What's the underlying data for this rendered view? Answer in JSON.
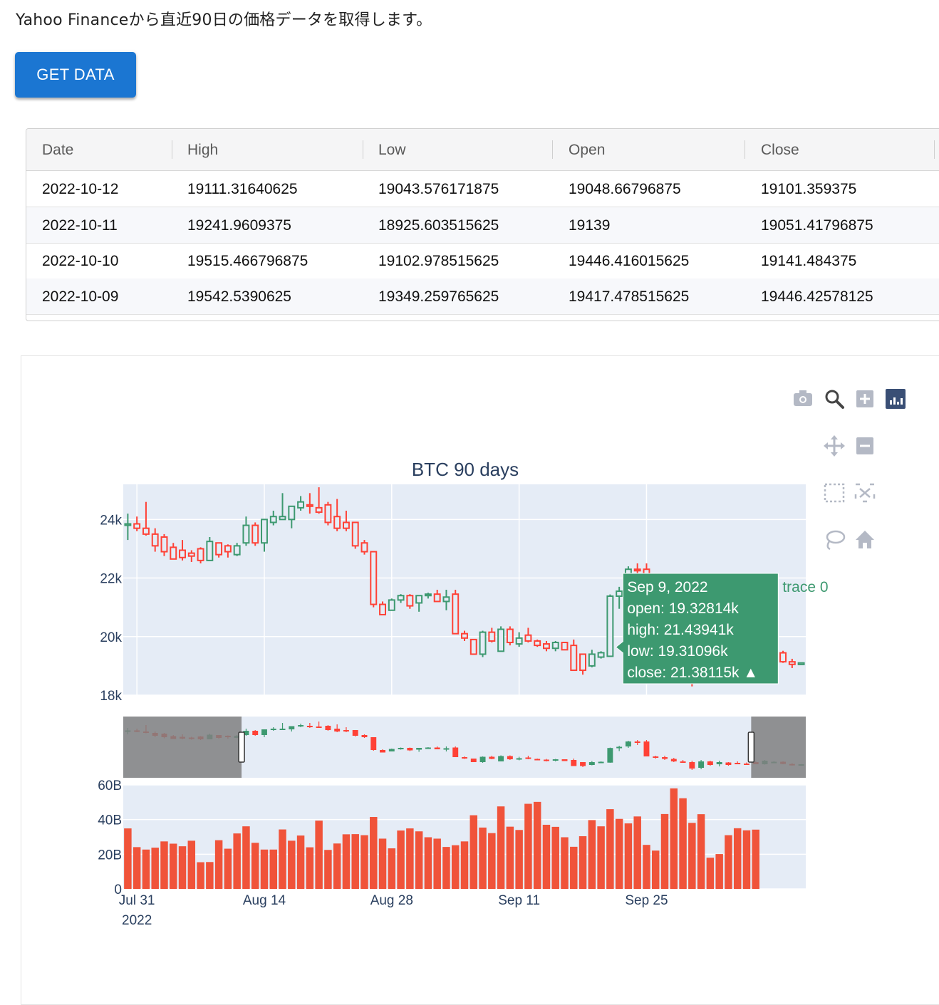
{
  "intro": {
    "text": "Yahoo Financeから直近90日の価格データを取得します。"
  },
  "button": {
    "label": "GET DATA"
  },
  "table": {
    "columns": [
      "Date",
      "High",
      "Low",
      "Open",
      "Close"
    ],
    "rows": [
      [
        "2022-10-12",
        "19111.31640625",
        "19043.576171875",
        "19048.66796875",
        "19101.359375"
      ],
      [
        "2022-10-11",
        "19241.9609375",
        "18925.603515625",
        "19139",
        "19051.41796875"
      ],
      [
        "2022-10-10",
        "19515.466796875",
        "19102.978515625",
        "19446.416015625",
        "19141.484375"
      ],
      [
        "2022-10-09",
        "19542.5390625",
        "19349.259765625",
        "19417.478515625",
        "19446.42578125"
      ]
    ]
  },
  "chart": {
    "title": "BTC 90 days",
    "colors": {
      "up": "#3d9970",
      "down": "#ff4136",
      "volume": "#f0533a",
      "plot_bg": "#e5ecf6",
      "title": "#2a3f5f",
      "tooltip_bg": "#3d9970",
      "range_mask": "#808080",
      "modebar_icon": "#b4b9c5",
      "modebar_active": "#3a4f75"
    },
    "hover": {
      "date": "Sep 9, 2022",
      "lines": [
        "open: 19.32814k",
        "high: 21.43941k",
        "low: 19.31096k",
        "close: 21.38115k  ▲"
      ],
      "trace": "trace 0"
    },
    "modebar": [
      "camera-icon",
      "zoom-icon",
      "zoom-in-icon",
      "bar-chart-icon",
      "pan-icon",
      "zoom-out-icon",
      "box-select-icon",
      "autoscale-icon",
      "lasso-icon",
      "home-icon"
    ]
  },
  "chart_data": [
    {
      "type": "candlestick",
      "title": "BTC 90 days",
      "xlabel": "",
      "ylabel": "",
      "x_start": "2022-07-30",
      "x_end": "2022-10-12",
      "visible_range": [
        "2022-07-30",
        "2022-10-12"
      ],
      "y_ticks": [
        "18k",
        "20k",
        "22k",
        "24k"
      ],
      "ylim": [
        18000,
        25200
      ],
      "x_ticks": [
        "Jul 31\n2022",
        "Aug 14",
        "Aug 28",
        "Sep 11",
        "Sep 25"
      ],
      "ohlc": [
        {
          "date": "2022-07-30",
          "o": 23800,
          "h": 24200,
          "l": 23300,
          "c": 23850
        },
        {
          "date": "2022-07-31",
          "o": 23850,
          "h": 24100,
          "l": 23600,
          "c": 23700
        },
        {
          "date": "2022-08-01",
          "o": 23700,
          "h": 24600,
          "l": 23450,
          "c": 23500
        },
        {
          "date": "2022-08-02",
          "o": 23500,
          "h": 23700,
          "l": 22900,
          "c": 23100
        },
        {
          "date": "2022-08-03",
          "o": 23400,
          "h": 23500,
          "l": 22750,
          "c": 22900
        },
        {
          "date": "2022-08-04",
          "o": 23050,
          "h": 23200,
          "l": 22650,
          "c": 22650
        },
        {
          "date": "2022-08-05",
          "o": 22950,
          "h": 23300,
          "l": 22600,
          "c": 22700
        },
        {
          "date": "2022-08-06",
          "o": 22850,
          "h": 22950,
          "l": 22550,
          "c": 22750
        },
        {
          "date": "2022-08-07",
          "o": 23000,
          "h": 23050,
          "l": 22500,
          "c": 22600
        },
        {
          "date": "2022-08-08",
          "o": 22600,
          "h": 23400,
          "l": 22600,
          "c": 23250
        },
        {
          "date": "2022-08-09",
          "o": 23200,
          "h": 23200,
          "l": 22700,
          "c": 22800
        },
        {
          "date": "2022-08-10",
          "o": 23100,
          "h": 23150,
          "l": 22700,
          "c": 22900
        },
        {
          "date": "2022-08-11",
          "o": 22800,
          "h": 23200,
          "l": 22750,
          "c": 23100
        },
        {
          "date": "2022-08-12",
          "o": 23200,
          "h": 24100,
          "l": 23100,
          "c": 23800
        },
        {
          "date": "2022-08-13",
          "o": 23800,
          "h": 23900,
          "l": 23100,
          "c": 23200
        },
        {
          "date": "2022-08-14",
          "o": 23200,
          "h": 24000,
          "l": 22900,
          "c": 24000
        },
        {
          "date": "2022-08-15",
          "o": 23900,
          "h": 24300,
          "l": 23800,
          "c": 24100
        },
        {
          "date": "2022-08-16",
          "o": 24000,
          "h": 24900,
          "l": 24000,
          "c": 24100
        },
        {
          "date": "2022-08-17",
          "o": 24000,
          "h": 24400,
          "l": 23700,
          "c": 24450
        },
        {
          "date": "2022-08-18",
          "o": 24400,
          "h": 24800,
          "l": 24300,
          "c": 24600
        },
        {
          "date": "2022-08-19",
          "o": 24500,
          "h": 24900,
          "l": 24200,
          "c": 24450
        },
        {
          "date": "2022-08-20",
          "o": 24400,
          "h": 25100,
          "l": 24200,
          "c": 24250
        },
        {
          "date": "2022-08-21",
          "o": 24500,
          "h": 24600,
          "l": 23800,
          "c": 23900
        },
        {
          "date": "2022-08-22",
          "o": 24100,
          "h": 24700,
          "l": 23600,
          "c": 23700
        },
        {
          "date": "2022-08-23",
          "o": 23900,
          "h": 24300,
          "l": 23600,
          "c": 23700
        },
        {
          "date": "2022-08-24",
          "o": 23900,
          "h": 23900,
          "l": 23000,
          "c": 23100
        },
        {
          "date": "2022-08-25",
          "o": 23200,
          "h": 23300,
          "l": 22800,
          "c": 22900
        },
        {
          "date": "2022-08-26",
          "o": 22900,
          "h": 22900,
          "l": 21000,
          "c": 21100
        },
        {
          "date": "2022-08-27",
          "o": 21100,
          "h": 21200,
          "l": 20750,
          "c": 20750
        },
        {
          "date": "2022-08-28",
          "o": 20900,
          "h": 21300,
          "l": 20900,
          "c": 21250
        },
        {
          "date": "2022-08-29",
          "o": 21250,
          "h": 21450,
          "l": 21150,
          "c": 21400
        },
        {
          "date": "2022-08-30",
          "o": 21400,
          "h": 21450,
          "l": 20950,
          "c": 21050
        },
        {
          "date": "2022-08-31",
          "o": 21150,
          "h": 21400,
          "l": 20850,
          "c": 21400
        },
        {
          "date": "2022-09-01",
          "o": 21400,
          "h": 21500,
          "l": 21300,
          "c": 21450
        },
        {
          "date": "2022-09-02",
          "o": 21450,
          "h": 21600,
          "l": 21200,
          "c": 21200
        },
        {
          "date": "2022-09-03",
          "o": 21200,
          "h": 21600,
          "l": 20900,
          "c": 21350
        },
        {
          "date": "2022-09-04",
          "o": 21450,
          "h": 21600,
          "l": 21000,
          "c": 20100
        },
        {
          "date": "2022-09-05",
          "o": 20100,
          "h": 20200,
          "l": 19850,
          "c": 19950
        },
        {
          "date": "2022-09-06",
          "o": 19900,
          "h": 19900,
          "l": 19400,
          "c": 19400
        },
        {
          "date": "2022-09-07",
          "o": 19400,
          "h": 20200,
          "l": 19300,
          "c": 20150
        },
        {
          "date": "2022-09-08",
          "o": 20150,
          "h": 20300,
          "l": 19800,
          "c": 19850
        },
        {
          "date": "2022-09-09",
          "o": 19500,
          "h": 20350,
          "l": 19500,
          "c": 20250
        },
        {
          "date": "2022-09-10",
          "o": 20250,
          "h": 20350,
          "l": 19700,
          "c": 19800
        },
        {
          "date": "2022-09-11",
          "o": 19750,
          "h": 20150,
          "l": 19650,
          "c": 19950
        },
        {
          "date": "2022-09-12",
          "o": 20050,
          "h": 20300,
          "l": 19800,
          "c": 19850
        },
        {
          "date": "2022-09-13",
          "o": 19850,
          "h": 19900,
          "l": 19650,
          "c": 19700
        },
        {
          "date": "2022-09-14",
          "o": 19750,
          "h": 19850,
          "l": 19500,
          "c": 19600
        },
        {
          "date": "2022-09-15",
          "o": 19600,
          "h": 19850,
          "l": 19500,
          "c": 19800
        },
        {
          "date": "2022-09-16",
          "o": 19800,
          "h": 19800,
          "l": 19550,
          "c": 19550
        },
        {
          "date": "2022-09-17",
          "o": 19700,
          "h": 19900,
          "l": 18900,
          "c": 18850
        },
        {
          "date": "2022-09-18",
          "o": 19400,
          "h": 19400,
          "l": 18700,
          "c": 18850
        },
        {
          "date": "2022-09-19",
          "o": 19000,
          "h": 19550,
          "l": 18950,
          "c": 19400
        },
        {
          "date": "2022-09-20",
          "o": 19300,
          "h": 19500,
          "l": 19250,
          "c": 19450
        },
        {
          "date": "2022-09-21",
          "o": 19328,
          "h": 21439,
          "l": 19311,
          "c": 21381
        },
        {
          "date": "2022-09-22",
          "o": 21381,
          "h": 21700,
          "l": 20950,
          "c": 21550
        },
        {
          "date": "2022-09-23",
          "o": 21600,
          "h": 22400,
          "l": 21400,
          "c": 22300
        },
        {
          "date": "2022-09-24",
          "o": 22300,
          "h": 22500,
          "l": 21800,
          "c": 22250
        },
        {
          "date": "2022-09-25",
          "o": 22300,
          "h": 22500,
          "l": 21600,
          "c": 20200
        },
        {
          "date": "2022-09-26",
          "o": 20200,
          "h": 20300,
          "l": 19900,
          "c": 20000
        },
        {
          "date": "2022-09-27",
          "o": 20100,
          "h": 20300,
          "l": 19700,
          "c": 19850
        },
        {
          "date": "2022-09-28",
          "o": 19850,
          "h": 20000,
          "l": 19400,
          "c": 19500
        },
        {
          "date": "2022-09-29",
          "o": 19500,
          "h": 19700,
          "l": 19300,
          "c": 19400
        },
        {
          "date": "2022-09-30",
          "o": 19400,
          "h": 19600,
          "l": 18300,
          "c": 18500
        },
        {
          "date": "2022-10-01",
          "o": 18600,
          "h": 19700,
          "l": 18400,
          "c": 19500
        },
        {
          "date": "2022-10-02",
          "o": 19500,
          "h": 19600,
          "l": 18900,
          "c": 19000
        },
        {
          "date": "2022-10-03",
          "o": 19100,
          "h": 19600,
          "l": 18800,
          "c": 19400
        },
        {
          "date": "2022-10-04",
          "o": 19350,
          "h": 19400,
          "l": 18900,
          "c": 19000
        },
        {
          "date": "2022-10-05",
          "o": 19300,
          "h": 19500,
          "l": 19100,
          "c": 19200
        },
        {
          "date": "2022-10-06",
          "o": 19200,
          "h": 19350,
          "l": 19000,
          "c": 19100
        },
        {
          "date": "2022-10-07",
          "o": 19400,
          "h": 19500,
          "l": 19100,
          "c": 19100
        },
        {
          "date": "2022-10-08",
          "o": 19100,
          "h": 19700,
          "l": 19050,
          "c": 19600
        },
        {
          "date": "2022-10-09",
          "o": 19417,
          "h": 19543,
          "l": 19349,
          "c": 19446
        },
        {
          "date": "2022-10-10",
          "o": 19446,
          "h": 19515,
          "l": 19103,
          "c": 19141
        },
        {
          "date": "2022-10-11",
          "o": 19139,
          "h": 19242,
          "l": 18926,
          "c": 19051
        },
        {
          "date": "2022-10-12",
          "o": 19049,
          "h": 19111,
          "l": 19044,
          "c": 19101
        }
      ]
    },
    {
      "type": "bar",
      "title": "",
      "y_ticks": [
        "0",
        "20B",
        "40B",
        "60B"
      ],
      "ylim": [
        0,
        60
      ],
      "unit": "B",
      "values": [
        34.9,
        24.1,
        22.7,
        23.8,
        27.4,
        26.1,
        24.6,
        27.8,
        15.4,
        15.5,
        28.1,
        23.2,
        32.0,
        36.1,
        26.6,
        22.7,
        22.7,
        34.3,
        27.8,
        30.8,
        24.0,
        39.4,
        22.5,
        26.2,
        31.5,
        31.6,
        31.0,
        41.5,
        29.0,
        23.4,
        33.7,
        34.9,
        33.2,
        29.8,
        29.0,
        24.2,
        25.2,
        27.4,
        42.5,
        35.4,
        32.2,
        47.6,
        35.9,
        34.0,
        49.1,
        50.2,
        37.0,
        35.8,
        29.8,
        24.3,
        30.4,
        39.7,
        36.1,
        46.0,
        40.4,
        37.8,
        41.8,
        25.4,
        22.1,
        43.2,
        58.0,
        52.3,
        38.1,
        43.1,
        18.0,
        20.1,
        31.0,
        35.0,
        33.8,
        34.2
      ]
    }
  ]
}
